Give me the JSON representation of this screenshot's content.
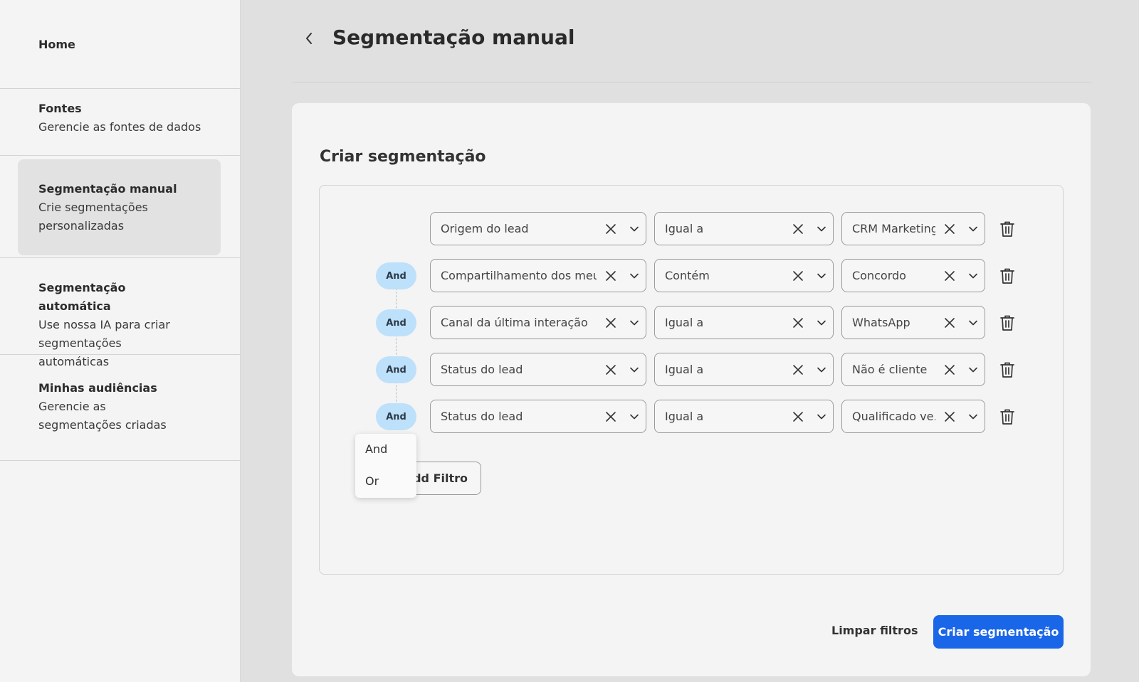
{
  "sidebar": {
    "home": "Home",
    "items": [
      {
        "title": "Fontes",
        "desc": "Gerencie as fontes de dados"
      },
      {
        "title": "Segmentação manual",
        "desc": "Crie segmentações personalizadas"
      },
      {
        "title": "Segmentação automática",
        "desc": "Use nossa IA para criar segmentações automáticas"
      },
      {
        "title": "Minhas audiências",
        "desc": "Gerencie as segmentações criadas"
      }
    ],
    "active_index": 1
  },
  "header": {
    "title": "Segmentação manual",
    "back_icon": "chevron-left-icon"
  },
  "card": {
    "title": "Criar segmentação"
  },
  "filters": [
    {
      "connector": "",
      "field": "Origem do lead",
      "operator": "Igual a",
      "value": "CRM Marketing"
    },
    {
      "connector": "And",
      "field": "Compartilhamento dos meu...",
      "operator": "Contém",
      "value": "Concordo"
    },
    {
      "connector": "And",
      "field": "Canal da última interação",
      "operator": "Igual a",
      "value": "WhatsApp"
    },
    {
      "connector": "And",
      "field": "Status do lead",
      "operator": "Igual a",
      "value": "Não é cliente"
    },
    {
      "connector": "And",
      "field": "Status do lead",
      "operator": "Igual a",
      "value": "Qualificado ve..."
    }
  ],
  "connector_dropdown": {
    "options": [
      "And",
      "Or"
    ]
  },
  "add_filter_label": "Add Filtro",
  "footer": {
    "clear_label": "Limpar filtros",
    "create_label": "Criar segmentação"
  },
  "colors": {
    "primary": "#1a66e8",
    "pill": "#bde0fb",
    "sidebar_active": "#e2e2e2"
  }
}
